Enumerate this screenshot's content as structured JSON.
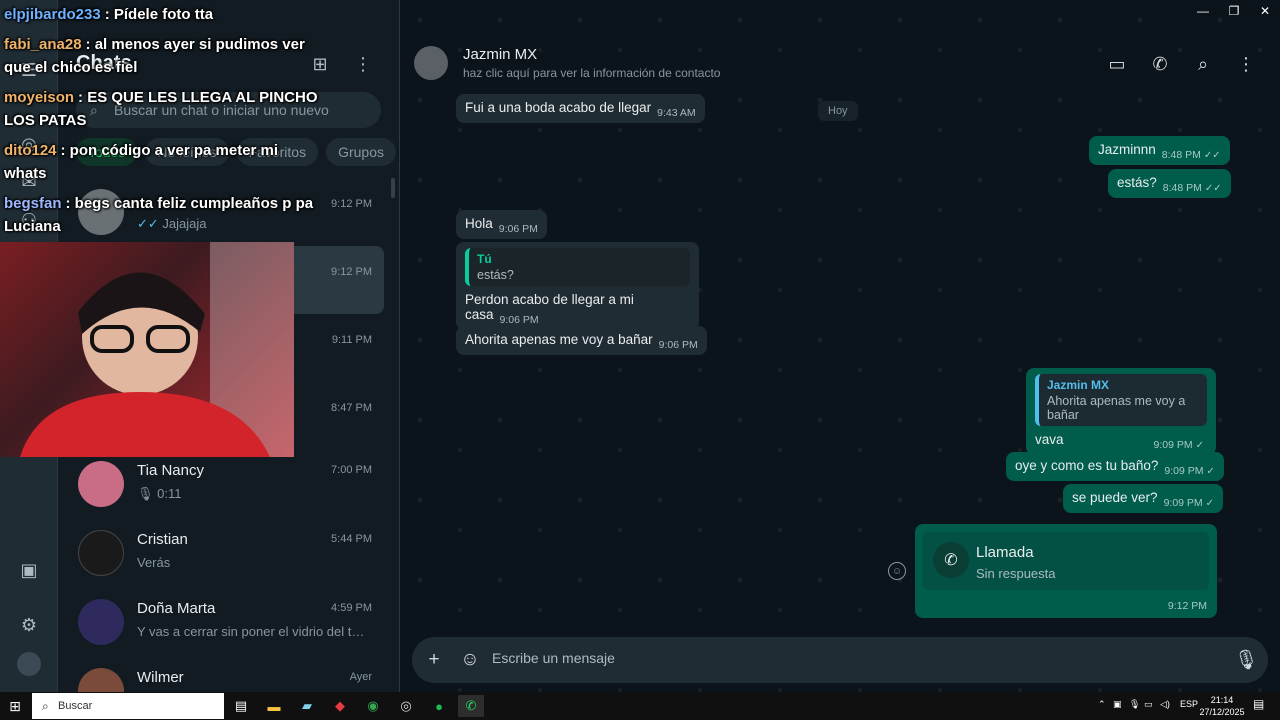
{
  "overlay_comments": [
    {
      "user": "elpjibardo233",
      "text": ": Pídele foto tta",
      "color": "#6fb0ff"
    },
    {
      "user": "fabi_ana28",
      "text": ": al menos ayer si pudimos ver que el chico es fiel",
      "color": "#f0b36a"
    },
    {
      "user": "moyeison",
      "text": ": ES QUE LES LLEGA AL PINCHO LOS PATAS",
      "color": "#f0b36a"
    },
    {
      "user": "dito124",
      "text": ": pon código a ver pa meter mi whats",
      "color": "#f0b36a"
    },
    {
      "user": "begsfan",
      "text": ": begs canta feliz cumpleaños p pa Luciana",
      "color": "#9db8ff"
    }
  ],
  "list": {
    "title": "Chats",
    "search_placeholder": "Buscar un chat o iniciar uno nuevo",
    "filters": [
      "Todos",
      "No leídos",
      "Favoritos",
      "Grupos"
    ],
    "chats": [
      {
        "name": "",
        "time": "9:12 PM",
        "preview": "Jajajaja"
      },
      {
        "name": "",
        "time": "9:12 PM",
        "preview": ""
      },
      {
        "name": "",
        "time": "9:11 PM",
        "preview": ""
      },
      {
        "name": "",
        "time": "8:47 PM",
        "preview": ""
      },
      {
        "name": "Tia Nancy",
        "time": "7:00 PM",
        "preview": "0:11"
      },
      {
        "name": "Cristian",
        "time": "5:44 PM",
        "preview": "Verás"
      },
      {
        "name": "Doña Marta",
        "time": "4:59 PM",
        "preview": "Y vas a cerrar sin poner el vidrio del tráiler"
      },
      {
        "name": "Wilmer",
        "time": "Ayer",
        "preview": ""
      }
    ]
  },
  "header": {
    "contact_name": "Jazmin MX",
    "contact_sub": "haz clic aquí para ver la información de contacto"
  },
  "messages": {
    "m1": {
      "text": "Fui a una boda acabo de llegar",
      "time": "9:43 AM"
    },
    "date_chip": "Hoy",
    "m2": {
      "text": "Jazminnn",
      "time": "8:48 PM"
    },
    "m3": {
      "text": "estás?",
      "time": "8:48 PM"
    },
    "m4": {
      "text": "Hola",
      "time": "9:06 PM"
    },
    "m5": {
      "quote_name": "Tú",
      "quote_text": "estás?",
      "text": "Perdon acabo de llegar a mi casa",
      "time": "9:06 PM"
    },
    "m6": {
      "text": "Ahorita apenas me voy a bañar",
      "time": "9:06 PM"
    },
    "m7": {
      "quote_name": "Jazmin MX",
      "quote_text": "Ahorita apenas me voy a bañar",
      "text": "vava",
      "time": "9:09 PM"
    },
    "m8": {
      "text": "oye y como es tu baño?",
      "time": "9:09 PM"
    },
    "m9": {
      "text": "se puede ver?",
      "time": "9:09 PM"
    },
    "call": {
      "title": "Llamada",
      "sub": "Sin respuesta",
      "time": "9:12 PM"
    }
  },
  "composer": {
    "placeholder": "Escribe un mensaje"
  },
  "taskbar": {
    "search_placeholder": "Buscar",
    "lang": "ESP",
    "time": "21:14",
    "date": "27/12/2025"
  },
  "colors": {
    "accent": "#25d366",
    "out_bubble": "#005c4b",
    "in_bubble": "#202c33",
    "bg": "#0b141a"
  }
}
